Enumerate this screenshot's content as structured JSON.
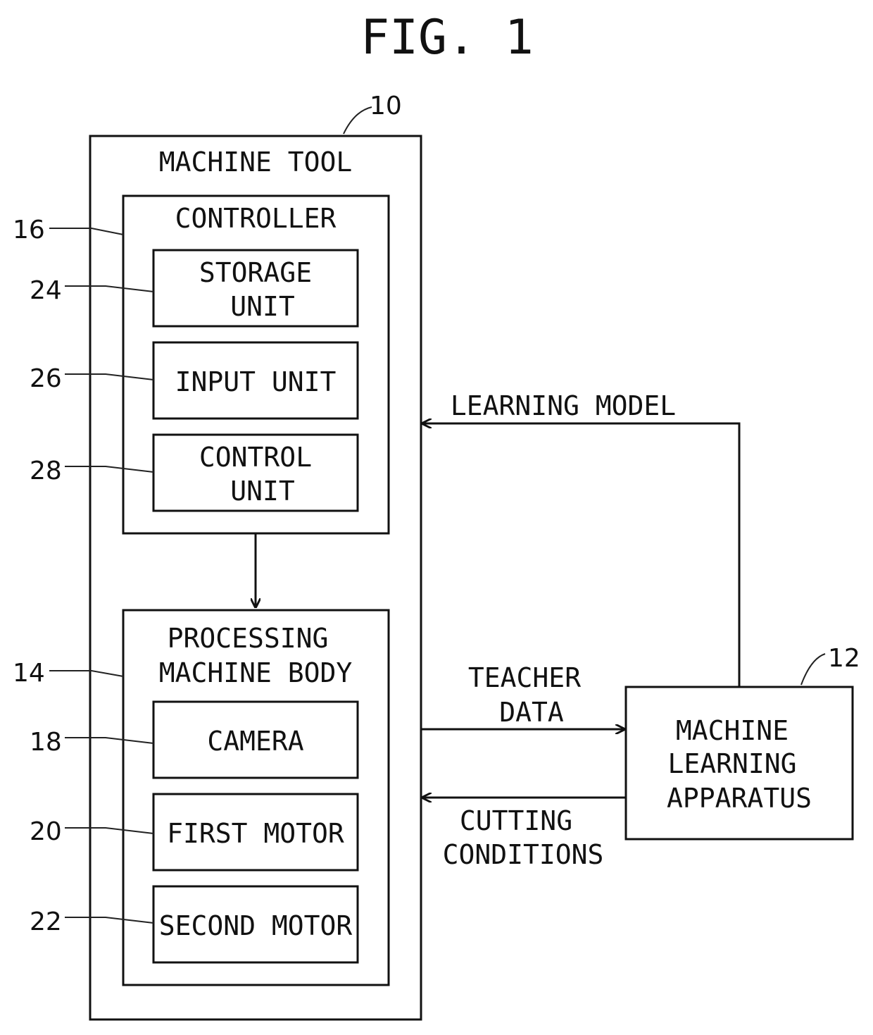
{
  "figure": {
    "title": "FIG. 1"
  },
  "machine_tool": {
    "ref": "10",
    "label": "MACHINE TOOL",
    "controller": {
      "ref": "16",
      "label": "CONTROLLER",
      "units": [
        {
          "ref": "24",
          "lines": [
            "STORAGE",
            "UNIT"
          ]
        },
        {
          "ref": "26",
          "lines": [
            "INPUT UNIT"
          ]
        },
        {
          "ref": "28",
          "lines": [
            "CONTROL",
            "UNIT"
          ]
        }
      ]
    },
    "processing_body": {
      "ref": "14",
      "lines": [
        "PROCESSING",
        "MACHINE BODY"
      ],
      "units": [
        {
          "ref": "18",
          "lines": [
            "CAMERA"
          ]
        },
        {
          "ref": "20",
          "lines": [
            "FIRST MOTOR"
          ]
        },
        {
          "ref": "22",
          "lines": [
            "SECOND MOTOR"
          ]
        }
      ]
    }
  },
  "ml_apparatus": {
    "ref": "12",
    "lines": [
      "MACHINE",
      "LEARNING",
      "APPARATUS"
    ]
  },
  "flows": {
    "learning_model": "LEARNING MODEL",
    "teacher_data": [
      "TEACHER",
      "DATA"
    ],
    "cutting_conditions": [
      "CUTTING",
      "CONDITIONS"
    ]
  }
}
